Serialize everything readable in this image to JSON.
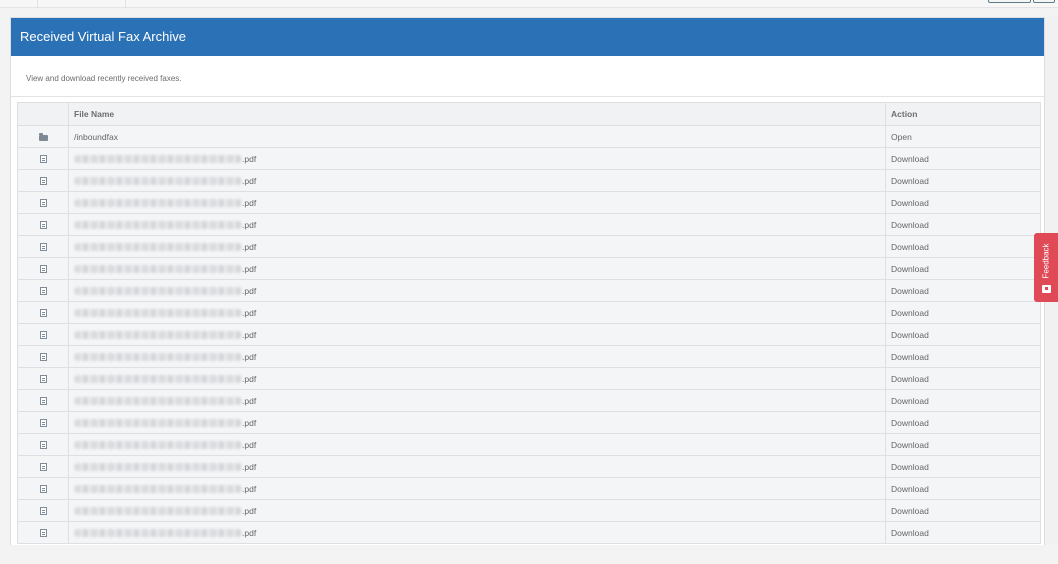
{
  "panel": {
    "title": "Received Virtual Fax Archive",
    "description": "View and download recently received faxes."
  },
  "table": {
    "columns": [
      "",
      "File Name",
      "Action"
    ],
    "folder_row": {
      "icon": "folder-icon",
      "name": "/inboundfax",
      "action": "Open"
    },
    "file_rows": [
      {
        "icon": "file-icon",
        "name_extension": ".pdf",
        "action": "Download"
      },
      {
        "icon": "file-icon",
        "name_extension": ".pdf",
        "action": "Download"
      },
      {
        "icon": "file-icon",
        "name_extension": ".pdf",
        "action": "Download"
      },
      {
        "icon": "file-icon",
        "name_extension": ".pdf",
        "action": "Download"
      },
      {
        "icon": "file-icon",
        "name_extension": ".pdf",
        "action": "Download"
      },
      {
        "icon": "file-icon",
        "name_extension": ".pdf",
        "action": "Download"
      },
      {
        "icon": "file-icon",
        "name_extension": ".pdf",
        "action": "Download"
      },
      {
        "icon": "file-icon",
        "name_extension": ".pdf",
        "action": "Download"
      },
      {
        "icon": "file-icon",
        "name_extension": ".pdf",
        "action": "Download"
      },
      {
        "icon": "file-icon",
        "name_extension": ".pdf",
        "action": "Download"
      },
      {
        "icon": "file-icon",
        "name_extension": ".pdf",
        "action": "Download"
      },
      {
        "icon": "file-icon",
        "name_extension": ".pdf",
        "action": "Download"
      },
      {
        "icon": "file-icon",
        "name_extension": ".pdf",
        "action": "Download"
      },
      {
        "icon": "file-icon",
        "name_extension": ".pdf",
        "action": "Download"
      },
      {
        "icon": "file-icon",
        "name_extension": ".pdf",
        "action": "Download"
      },
      {
        "icon": "file-icon",
        "name_extension": ".pdf",
        "action": "Download"
      },
      {
        "icon": "file-icon",
        "name_extension": ".pdf",
        "action": "Download"
      },
      {
        "icon": "file-icon",
        "name_extension": ".pdf",
        "action": "Download"
      }
    ]
  },
  "feedback": {
    "label": "Feedback",
    "icon": "feedback-icon"
  },
  "colors": {
    "header_blue": "#2b71b5",
    "feedback_red": "#e04a57"
  }
}
